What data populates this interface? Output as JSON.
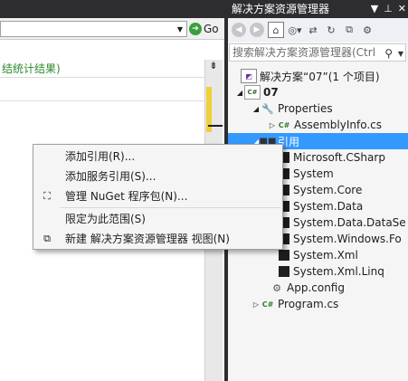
{
  "editor": {
    "url_value": "",
    "go_label": "Go",
    "find_result_text": "结统计结果)"
  },
  "solution_explorer": {
    "title": "解决方案资源管理器",
    "search_placeholder": "搜索解决方案资源管理器(Ctrl",
    "tree": {
      "solution": "解决方案“07”(1 个项目)",
      "project": "07",
      "properties": "Properties",
      "assembly_info": "AssemblyInfo.cs",
      "references": "引用",
      "reference_items": [
        "Microsoft.CSharp",
        "System",
        "System.Core",
        "System.Data",
        "System.Data.DataSe",
        "System.Windows.Fo",
        "System.Xml",
        "System.Xml.Linq"
      ],
      "app_config": "App.config",
      "program": "Program.cs"
    }
  },
  "context_menu": {
    "items": [
      "添加引用(R)...",
      "添加服务引用(S)...",
      "管理 NuGet 程序包(N)...",
      "限定为此范围(S)",
      "新建 解决方案资源管理器 视图(N)"
    ]
  }
}
